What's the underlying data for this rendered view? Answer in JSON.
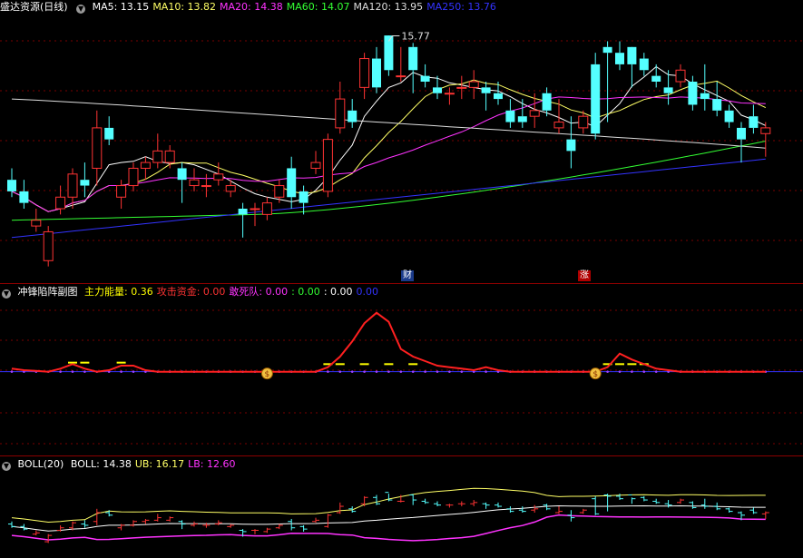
{
  "main": {
    "title": "盛达资源(日线)",
    "ma": [
      {
        "label": "MA5: 13.15",
        "color": "#ffffff"
      },
      {
        "label": "MA10: 13.82",
        "color": "#ffff66"
      },
      {
        "label": "MA20: 14.38",
        "color": "#ff33ff"
      },
      {
        "label": "MA60: 14.07",
        "color": "#33ff33"
      },
      {
        "label": "MA120: 13.95",
        "color": "#dddddd"
      },
      {
        "label": "MA250: 13.76",
        "color": "#3333ff"
      }
    ],
    "high_label": "15.77",
    "badge_cai": "财",
    "badge_zhang": "涨"
  },
  "sub1": {
    "title": "冲锋陷阵副图",
    "items": [
      {
        "label": "主力能量: 0.36",
        "color": "#ffff00"
      },
      {
        "label": "攻击资金: 0.00",
        "color": "#ff3333"
      },
      {
        "label": "敢死队: 0.00",
        "color": "#ff33ff"
      },
      {
        "label": ": 0.00",
        "color": "#33ff33"
      },
      {
        "label": ": 0.00",
        "color": "#ffffff"
      },
      {
        "label": "0.00",
        "color": "#3333ff"
      }
    ]
  },
  "sub2": {
    "title": "BOLL(20)",
    "items": [
      {
        "label": "BOLL: 14.38",
        "color": "#ffffff"
      },
      {
        "label": "UB: 16.17",
        "color": "#ffff66"
      },
      {
        "label": "LB: 12.60",
        "color": "#ff33ff"
      }
    ]
  },
  "colors": {
    "up": "#ff3333",
    "down": "#54ffff",
    "grid": "#7a0000"
  },
  "chart_data": [
    {
      "type": "candlestick",
      "title": "盛达资源(日线)",
      "ohlc": [
        [
          13.4,
          13.6,
          13.1,
          13.2
        ],
        [
          13.2,
          13.4,
          12.9,
          13.0
        ],
        [
          12.6,
          12.9,
          12.5,
          12.7
        ],
        [
          12.0,
          12.6,
          11.9,
          12.5
        ],
        [
          12.9,
          13.3,
          12.8,
          13.1
        ],
        [
          13.1,
          13.6,
          12.9,
          13.5
        ],
        [
          13.4,
          13.7,
          13.1,
          13.3
        ],
        [
          13.6,
          14.6,
          13.3,
          14.3
        ],
        [
          14.3,
          14.5,
          14.0,
          14.1
        ],
        [
          13.1,
          13.4,
          12.9,
          13.3
        ],
        [
          13.3,
          13.7,
          13.2,
          13.6
        ],
        [
          13.6,
          13.8,
          13.4,
          13.7
        ],
        [
          13.7,
          14.2,
          13.6,
          13.9
        ],
        [
          13.7,
          14.0,
          13.6,
          13.9
        ],
        [
          13.6,
          13.7,
          13.0,
          13.4
        ],
        [
          13.3,
          13.6,
          13.2,
          13.4
        ],
        [
          13.3,
          13.5,
          13.1,
          13.3
        ],
        [
          13.4,
          13.7,
          13.3,
          13.5
        ],
        [
          13.2,
          13.4,
          13.1,
          13.3
        ],
        [
          12.9,
          13.0,
          12.4,
          12.8
        ],
        [
          12.9,
          13.0,
          12.6,
          12.9
        ],
        [
          12.8,
          13.1,
          12.7,
          13.0
        ],
        [
          13.1,
          13.4,
          13.0,
          13.3
        ],
        [
          13.6,
          13.8,
          12.9,
          13.1
        ],
        [
          13.2,
          13.3,
          12.8,
          13.0
        ],
        [
          13.6,
          13.9,
          13.5,
          13.7
        ],
        [
          13.2,
          14.2,
          13.1,
          14.1
        ],
        [
          14.3,
          15.1,
          14.2,
          14.8
        ],
        [
          14.6,
          14.8,
          14.3,
          14.4
        ],
        [
          15.0,
          15.6,
          14.8,
          15.5
        ],
        [
          15.5,
          15.7,
          14.9,
          15.0
        ],
        [
          15.9,
          15.8,
          15.2,
          15.3
        ],
        [
          15.2,
          15.7,
          15.1,
          15.2
        ],
        [
          15.7,
          15.77,
          14.9,
          15.3
        ],
        [
          15.2,
          15.4,
          15.0,
          15.1
        ],
        [
          15.0,
          15.2,
          14.8,
          14.9
        ],
        [
          14.9,
          15.0,
          14.7,
          14.9
        ],
        [
          15.0,
          15.2,
          14.8,
          15.0
        ],
        [
          15.0,
          15.3,
          14.8,
          15.1
        ],
        [
          15.0,
          15.1,
          14.6,
          14.9
        ],
        [
          14.9,
          15.1,
          14.7,
          14.8
        ],
        [
          14.6,
          14.8,
          14.3,
          14.4
        ],
        [
          14.5,
          14.8,
          14.3,
          14.4
        ],
        [
          14.5,
          14.9,
          14.3,
          14.6
        ],
        [
          14.9,
          15.0,
          14.5,
          14.6
        ],
        [
          14.3,
          14.8,
          14.2,
          14.4
        ],
        [
          14.1,
          14.5,
          13.6,
          13.9
        ],
        [
          14.3,
          14.6,
          14.2,
          14.5
        ],
        [
          15.4,
          15.6,
          14.1,
          14.2
        ],
        [
          15.7,
          15.8,
          14.4,
          15.6
        ],
        [
          15.6,
          15.8,
          15.3,
          15.4
        ],
        [
          15.7,
          15.5,
          15.0,
          15.4
        ],
        [
          15.5,
          15.6,
          15.2,
          15.3
        ],
        [
          15.2,
          15.4,
          15.0,
          15.1
        ],
        [
          15.0,
          15.3,
          14.7,
          14.9
        ],
        [
          15.1,
          15.4,
          15.0,
          15.3
        ],
        [
          15.1,
          15.2,
          14.6,
          14.7
        ],
        [
          14.9,
          15.4,
          14.6,
          14.8
        ],
        [
          14.8,
          15.1,
          14.5,
          14.6
        ],
        [
          14.6,
          14.7,
          14.3,
          14.4
        ],
        [
          14.3,
          14.4,
          13.7,
          14.1
        ],
        [
          14.5,
          14.7,
          14.2,
          14.3
        ],
        [
          14.2,
          14.4,
          13.8,
          14.3
        ]
      ],
      "series": [
        {
          "name": "MA5",
          "color": "#ffffff"
        },
        {
          "name": "MA10",
          "color": "#ffff66"
        },
        {
          "name": "MA20",
          "color": "#ff33ff"
        },
        {
          "name": "MA60",
          "color": "#33ff33"
        },
        {
          "name": "MA120",
          "color": "#dddddd"
        },
        {
          "name": "MA250",
          "color": "#3333ff"
        }
      ],
      "ylim": [
        11.8,
        16.2
      ]
    },
    {
      "type": "line",
      "title": "冲锋陷阵副图",
      "attack": [
        0.2,
        0.1,
        0.05,
        0.0,
        0.2,
        0.5,
        0.2,
        0.0,
        0.1,
        0.4,
        0.4,
        0.1,
        0.0,
        0.0,
        0.0,
        0.0,
        0.0,
        0.0,
        0.0,
        0.0,
        0.0,
        0.0,
        0.0,
        0.0,
        0.0,
        0.0,
        0.3,
        1.0,
        2.0,
        3.2,
        3.9,
        3.3,
        1.5,
        1.0,
        0.7,
        0.4,
        0.3,
        0.2,
        0.1,
        0.3,
        0.1,
        0.0,
        0.0,
        0.0,
        0.0,
        0.0,
        0.0,
        0.0,
        0.0,
        0.3,
        1.2,
        0.8,
        0.5,
        0.2,
        0.1,
        0.0,
        0.0,
        0.0,
        0.0,
        0.0,
        0.0,
        0.0,
        0.0
      ],
      "dash_points": [
        [
          5,
          0.6
        ],
        [
          6,
          0.6
        ],
        [
          9,
          0.6
        ],
        [
          26,
          0.5
        ],
        [
          27,
          0.5
        ],
        [
          29,
          0.5
        ],
        [
          31,
          0.5
        ],
        [
          33,
          0.5
        ],
        [
          49,
          0.5
        ],
        [
          50,
          0.5
        ],
        [
          51,
          0.5
        ],
        [
          52,
          0.5
        ]
      ],
      "signal_points": [
        21,
        48
      ],
      "ylim": [
        -0.2,
        4.6
      ]
    },
    {
      "type": "line",
      "title": "BOLL(20)",
      "series": [
        {
          "name": "BOLL",
          "color": "#ffffff"
        },
        {
          "name": "UB",
          "color": "#ffff66"
        },
        {
          "name": "LB",
          "color": "#ff33ff"
        }
      ],
      "ylim": [
        11.0,
        17.6
      ]
    }
  ]
}
